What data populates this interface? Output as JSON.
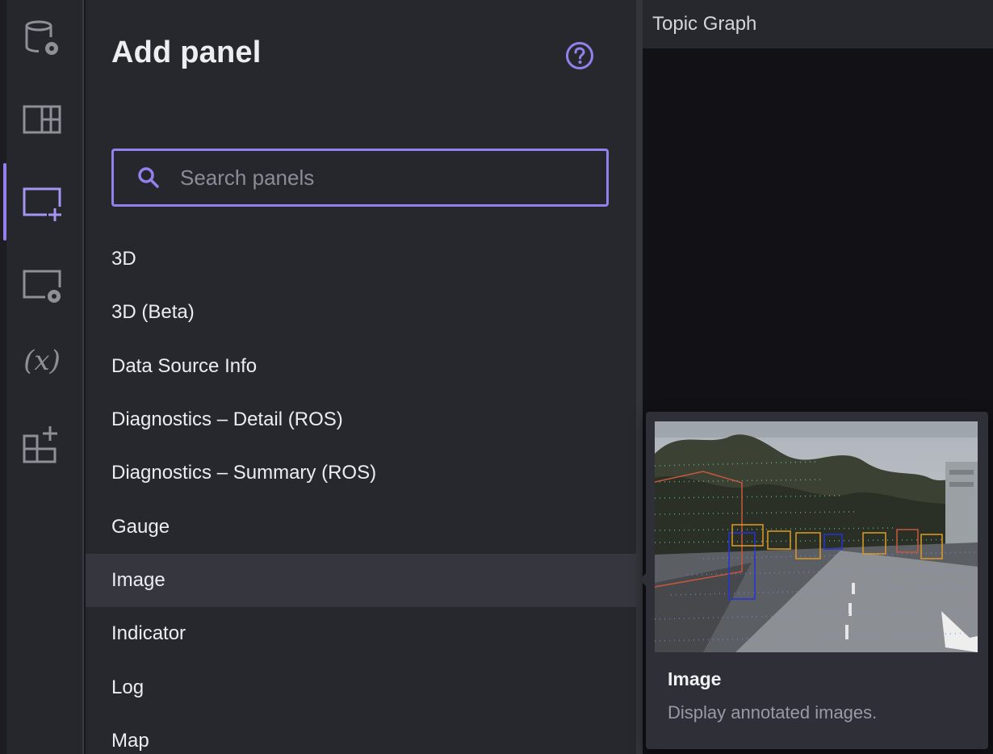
{
  "sidebar": {
    "items": [
      {
        "icon": "database-settings-icon",
        "active": false
      },
      {
        "icon": "layout-icon",
        "active": false
      },
      {
        "icon": "add-panel-icon",
        "active": true
      },
      {
        "icon": "panel-settings-icon",
        "active": false
      },
      {
        "icon": "variables-icon",
        "active": false,
        "glyph": "(x)"
      },
      {
        "icon": "extensions-icon",
        "active": false
      }
    ]
  },
  "add_panel": {
    "title": "Add panel",
    "help_icon": "help-circle-icon",
    "search": {
      "placeholder": "Search panels",
      "value": ""
    },
    "panels": [
      "3D",
      "3D (Beta)",
      "Data Source Info",
      "Diagnostics – Detail (ROS)",
      "Diagnostics – Summary (ROS)",
      "Gauge",
      "Image",
      "Indicator",
      "Log",
      "Map"
    ],
    "hovered": "Image"
  },
  "right_pane": {
    "title": "Topic Graph"
  },
  "preview": {
    "title": "Image",
    "description": "Display annotated images."
  },
  "colors": {
    "accent": "#9480ed",
    "panel_bg": "#27272e",
    "hover_bg": "#36363f"
  }
}
